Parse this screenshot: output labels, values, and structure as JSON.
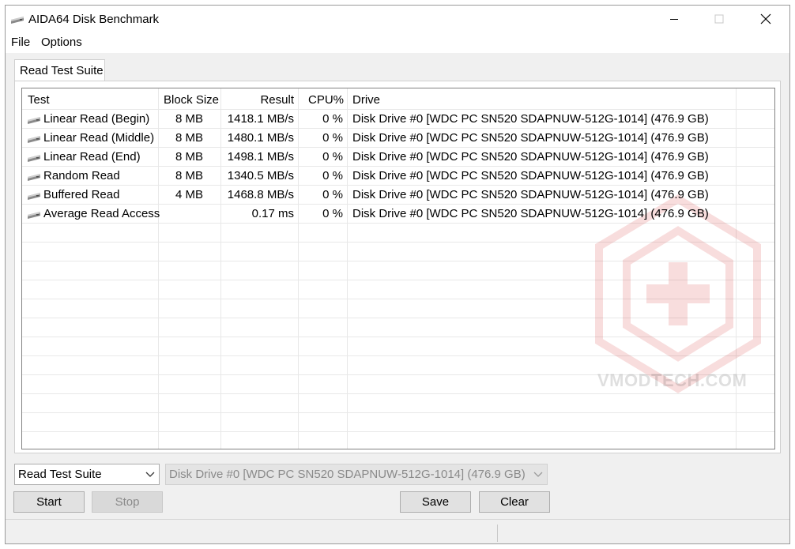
{
  "window": {
    "title": "AIDA64 Disk Benchmark"
  },
  "menu": {
    "file": "File",
    "options": "Options"
  },
  "tab": {
    "label": "Read Test Suite"
  },
  "table": {
    "headers": {
      "test": "Test",
      "block_size": "Block Size",
      "result": "Result",
      "cpu": "CPU%",
      "drive": "Drive"
    },
    "rows": [
      {
        "test": "Linear Read (Begin)",
        "block_size": "8 MB",
        "result": "1418.1 MB/s",
        "cpu": "0 %",
        "drive": "Disk Drive #0  [WDC PC SN520 SDAPNUW-512G-1014]  (476.9 GB)"
      },
      {
        "test": "Linear Read (Middle)",
        "block_size": "8 MB",
        "result": "1480.1 MB/s",
        "cpu": "0 %",
        "drive": "Disk Drive #0  [WDC PC SN520 SDAPNUW-512G-1014]  (476.9 GB)"
      },
      {
        "test": "Linear Read (End)",
        "block_size": "8 MB",
        "result": "1498.1 MB/s",
        "cpu": "0 %",
        "drive": "Disk Drive #0  [WDC PC SN520 SDAPNUW-512G-1014]  (476.9 GB)"
      },
      {
        "test": "Random Read",
        "block_size": "8 MB",
        "result": "1340.5 MB/s",
        "cpu": "0 %",
        "drive": "Disk Drive #0  [WDC PC SN520 SDAPNUW-512G-1014]  (476.9 GB)"
      },
      {
        "test": "Buffered Read",
        "block_size": "4 MB",
        "result": "1468.8 MB/s",
        "cpu": "0 %",
        "drive": "Disk Drive #0  [WDC PC SN520 SDAPNUW-512G-1014]  (476.9 GB)"
      },
      {
        "test": "Average Read Access",
        "block_size": "",
        "result": "0.17 ms",
        "cpu": "0 %",
        "drive": "Disk Drive #0  [WDC PC SN520 SDAPNUW-512G-1014]  (476.9 GB)"
      }
    ]
  },
  "watermark": {
    "text": "VMODTECH.COM"
  },
  "controls": {
    "test_select": "Read Test Suite",
    "drive_select": "Disk Drive #0  [WDC PC SN520 SDAPNUW-512G-1014]  (476.9 GB)",
    "start": "Start",
    "stop": "Stop",
    "save": "Save",
    "clear": "Clear"
  },
  "icons": {
    "app": "disk-drive-icon",
    "row": "disk-drive-icon",
    "minimize": "minimize-icon",
    "maximize": "maximize-icon",
    "close": "close-icon",
    "dropdown": "chevron-down-icon"
  }
}
